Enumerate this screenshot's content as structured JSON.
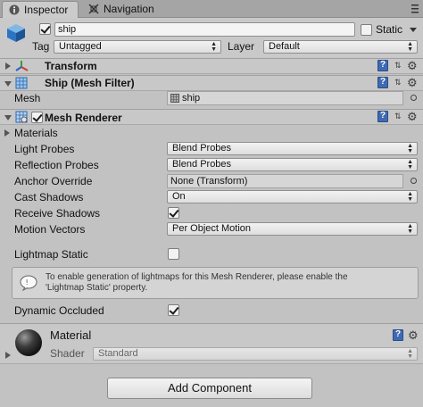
{
  "tabs": [
    {
      "label": "Inspector",
      "icon": "info-icon",
      "active": true
    },
    {
      "label": "Navigation",
      "icon": "navigation-icon",
      "active": false
    }
  ],
  "header": {
    "object_name": "ship",
    "static_label": "Static",
    "tag_label": "Tag",
    "tag_value": "Untagged",
    "layer_label": "Layer",
    "layer_value": "Default"
  },
  "components": {
    "transform": {
      "title": "Transform"
    },
    "mesh_filter": {
      "title": "Ship (Mesh Filter)",
      "mesh_label": "Mesh",
      "mesh_value": "ship"
    },
    "mesh_renderer": {
      "title": "Mesh Renderer",
      "materials_label": "Materials",
      "rows": [
        {
          "label": "Light Probes",
          "value": "Blend Probes"
        },
        {
          "label": "Reflection Probes",
          "value": "Blend Probes"
        },
        {
          "label": "Anchor Override",
          "value": "None (Transform)"
        },
        {
          "label": "Cast Shadows",
          "value": "On"
        },
        {
          "label": "Receive Shadows",
          "value": ""
        },
        {
          "label": "Motion Vectors",
          "value": "Per Object Motion"
        }
      ],
      "lightmap_static_label": "Lightmap Static",
      "help_text_line1": "To enable generation of lightmaps for this Mesh Renderer, please enable the",
      "help_text_line2": "'Lightmap Static' property.",
      "dynamic_occluded_label": "Dynamic Occluded"
    }
  },
  "material": {
    "title": "Material",
    "shader_label": "Shader",
    "shader_value": "Standard"
  },
  "add_component_label": "Add Component",
  "colors": {
    "panel": "#c2c2c2",
    "header": "#c8c8c8",
    "accent_blue": "#3f6ab3"
  }
}
